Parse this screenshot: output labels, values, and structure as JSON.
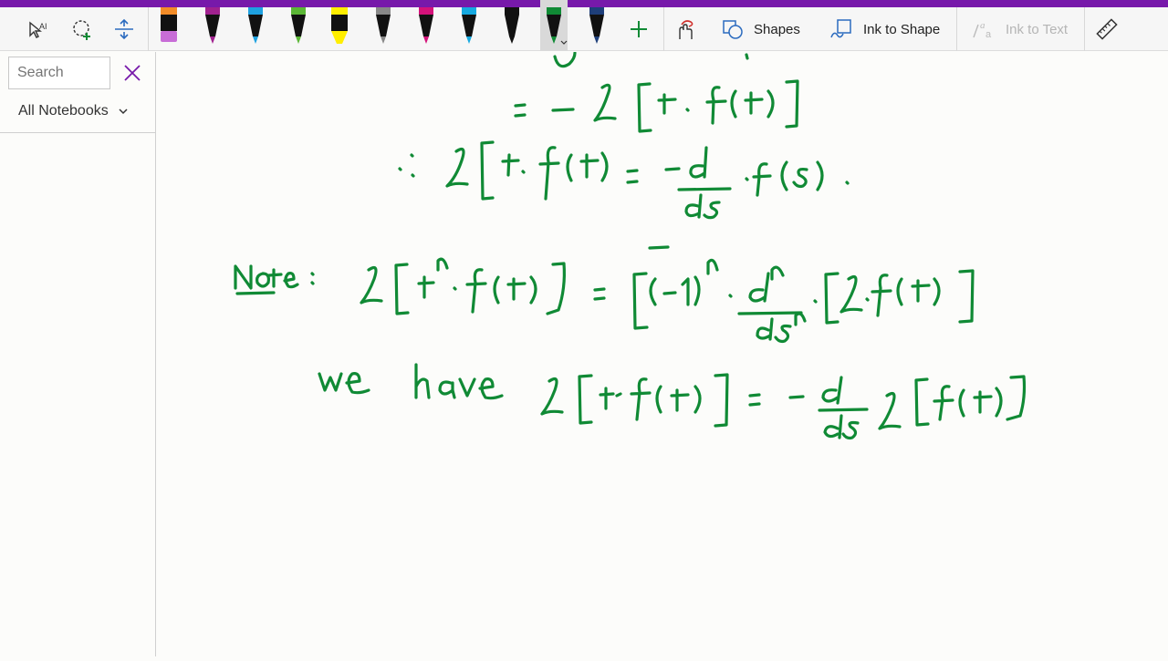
{
  "toolbar": {
    "shapes_label": "Shapes",
    "ink_to_shape_label": "Ink to Shape",
    "ink_to_text_label": "Ink to Text",
    "pens": [
      {
        "name": "highlighter-orange",
        "color": "#f28c28"
      },
      {
        "name": "pen-purple",
        "color": "#a0218f"
      },
      {
        "name": "pen-blue",
        "color": "#1ea1e0"
      },
      {
        "name": "pen-green",
        "color": "#5bb736"
      },
      {
        "name": "highlighter-yellow",
        "color": "#ffee00"
      },
      {
        "name": "pen-galaxy",
        "color": "#888888"
      },
      {
        "name": "pen-magenta",
        "color": "#d4127a"
      },
      {
        "name": "pen-cyan",
        "color": "#17a9e0"
      },
      {
        "name": "pen-black",
        "color": "#111111"
      },
      {
        "name": "pen-dark-green",
        "color": "#108a35"
      },
      {
        "name": "pen-navy",
        "color": "#1e3f7a"
      }
    ],
    "accent_color": "#7719aa",
    "ink_color": "#108a35"
  },
  "sidebar": {
    "search_placeholder": "Search",
    "notebook_filter": "All Notebooks"
  }
}
